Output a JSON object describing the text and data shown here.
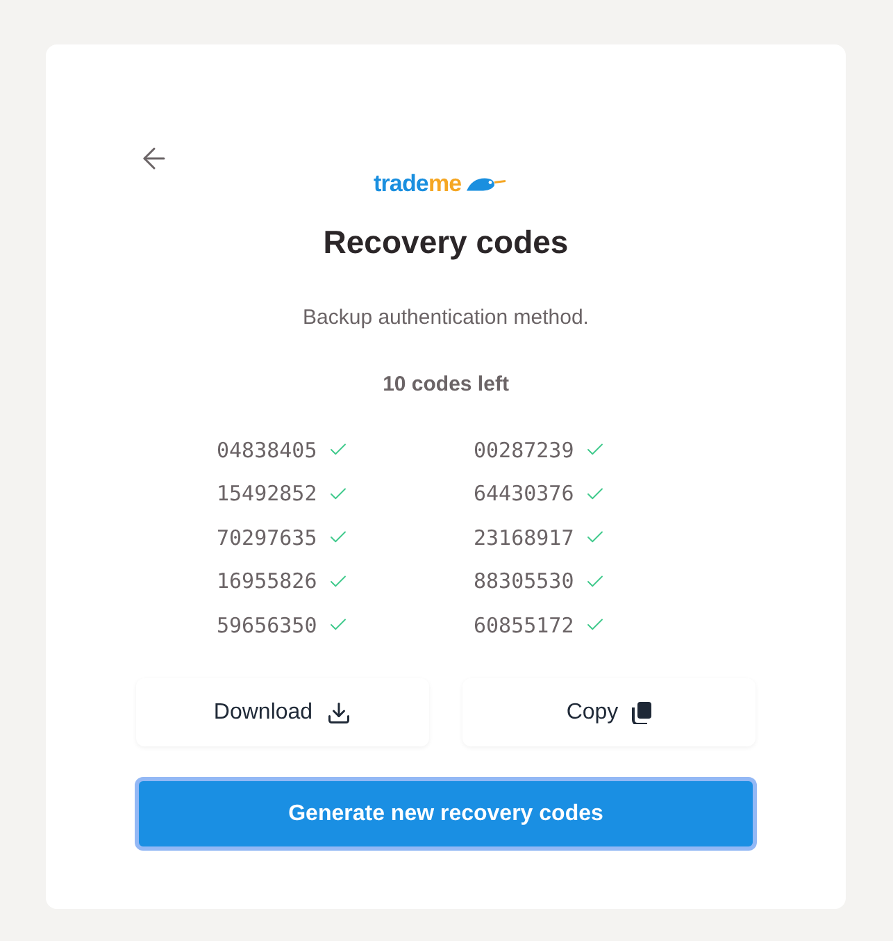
{
  "logo": {
    "part_1": "trade",
    "part_2": "me"
  },
  "title": "Recovery codes",
  "subtitle": "Backup authentication method.",
  "codes_left": "10 codes left",
  "codes": [
    {
      "code": "04838405",
      "checked": true
    },
    {
      "code": "00287239",
      "checked": true
    },
    {
      "code": "15492852",
      "checked": true
    },
    {
      "code": "64430376",
      "checked": true
    },
    {
      "code": "70297635",
      "checked": true
    },
    {
      "code": "23168917",
      "checked": true
    },
    {
      "code": "16955826",
      "checked": true
    },
    {
      "code": "88305530",
      "checked": true
    },
    {
      "code": "59656350",
      "checked": true
    },
    {
      "code": "60855172",
      "checked": true
    }
  ],
  "buttons": [
    {
      "label": "Download",
      "kind": "download"
    },
    {
      "label": "Copy",
      "kind": "copy"
    }
  ],
  "primary_button": "Generate new recovery codes"
}
